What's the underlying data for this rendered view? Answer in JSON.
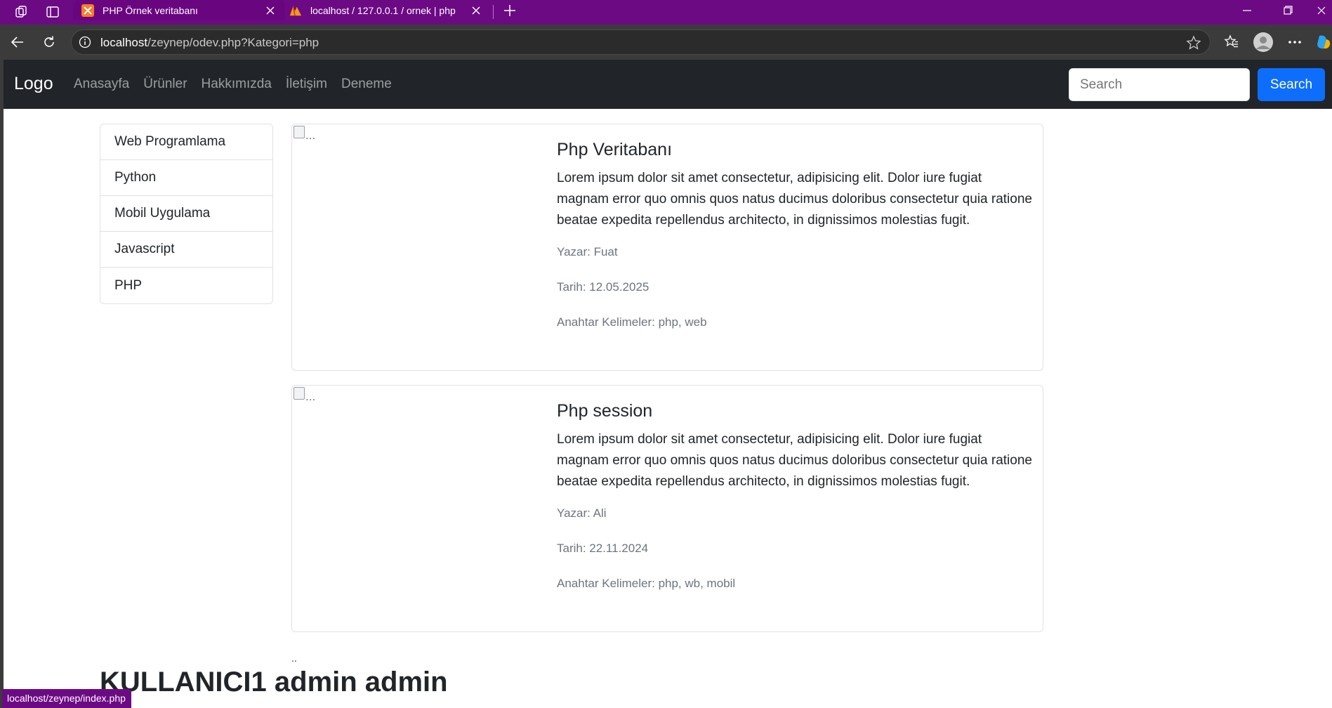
{
  "browser": {
    "tabs": [
      {
        "title": "PHP Örnek veritabanı",
        "active": true
      },
      {
        "title": "localhost / 127.0.0.1 / ornek | php",
        "active": false
      }
    ],
    "address": {
      "host": "localhost",
      "path": "/zeynep/odev.php?Kategori=php"
    },
    "status_link": "localhost/zeynep/index.php",
    "colors": {
      "tabbar": "#6c0a84",
      "toolbar": "#3b3b3b"
    }
  },
  "navbar": {
    "brand": "Logo",
    "links": [
      "Anasayfa",
      "Ürünler",
      "Hakkımızda",
      "İletişim",
      "Deneme"
    ],
    "search_placeholder": "Search",
    "search_button": "Search",
    "colors": {
      "background": "#212529",
      "button": "#0d6efd"
    }
  },
  "sidebar": {
    "items": [
      {
        "label": "Web Programlama"
      },
      {
        "label": "Python"
      },
      {
        "label": "Mobil Uygulama"
      },
      {
        "label": "Javascript"
      },
      {
        "label": "PHP"
      }
    ]
  },
  "posts": [
    {
      "image_alt": "...",
      "title": "Php Veritabanı",
      "text": "Lorem ipsum dolor sit amet consectetur, adipisicing elit. Dolor iure fugiat magnam error quo omnis quos natus ducimus doloribus consectetur quia ratione beatae expedita repellendus architecto, in dignissimos molestias fugit.",
      "author": "Yazar: Fuat",
      "date": "Tarih: 12.05.2025",
      "keywords": "Anahtar Kelimeler: php, web"
    },
    {
      "image_alt": "...",
      "title": "Php session",
      "text": "Lorem ipsum dolor sit amet consectetur, adipisicing elit. Dolor iure fugiat magnam error quo omnis quos natus ducimus doloribus consectetur quia ratione beatae expedita repellendus architecto, in dignissimos molestias fugit.",
      "author": "Yazar: Ali",
      "date": "Tarih: 22.11.2024",
      "keywords": "Anahtar Kelimeler: php, wb, mobil"
    }
  ],
  "footer": {
    "dots": "..",
    "user_heading": "KULLANICI1 admin admin"
  }
}
